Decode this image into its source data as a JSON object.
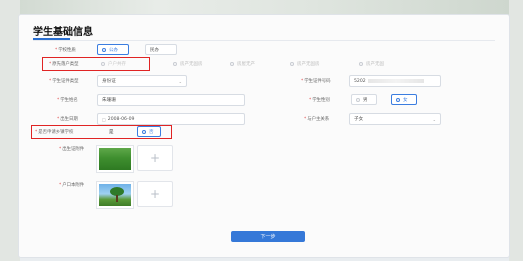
{
  "page_title": "学生基础信息",
  "fields": {
    "school_nature": {
      "label": "学校性质",
      "options": [
        "公办",
        "民办"
      ],
      "selected": "公办"
    },
    "original_hukou_type": {
      "label": "原先落户类型",
      "options": [
        "户户共存",
        "房产无固房",
        "房屋无产",
        "房产无固房",
        "房产无固"
      ],
      "selected": "户户共存"
    },
    "student_id_type": {
      "label": "学生证件类型",
      "value": "身份证"
    },
    "student_id_number": {
      "label": "学生证件号码",
      "value_prefix": "5202"
    },
    "student_name": {
      "label": "学生姓名",
      "value": "朱珊珊"
    },
    "student_gender": {
      "label": "学生性别",
      "options": [
        "男",
        "女"
      ],
      "selected": "女"
    },
    "birth_date": {
      "label": "出生日期",
      "value": "2008-06-09"
    },
    "guardian_relation": {
      "label": "与户主关系",
      "value": "子女"
    },
    "rural_hukou": {
      "label": "是否申请乡镇学校",
      "options": [
        "是",
        "否"
      ],
      "selected": "否"
    },
    "birth_certificate": {
      "label": "出生证附件"
    },
    "hukou_book": {
      "label": "户口本附件"
    }
  },
  "next_button": "下一步",
  "colors": {
    "accent": "#3578d8",
    "highlight_box": "#e02424",
    "required": "#e04b4b"
  },
  "icons": {
    "add": "plus-icon",
    "radio": "radio-dot-icon"
  }
}
